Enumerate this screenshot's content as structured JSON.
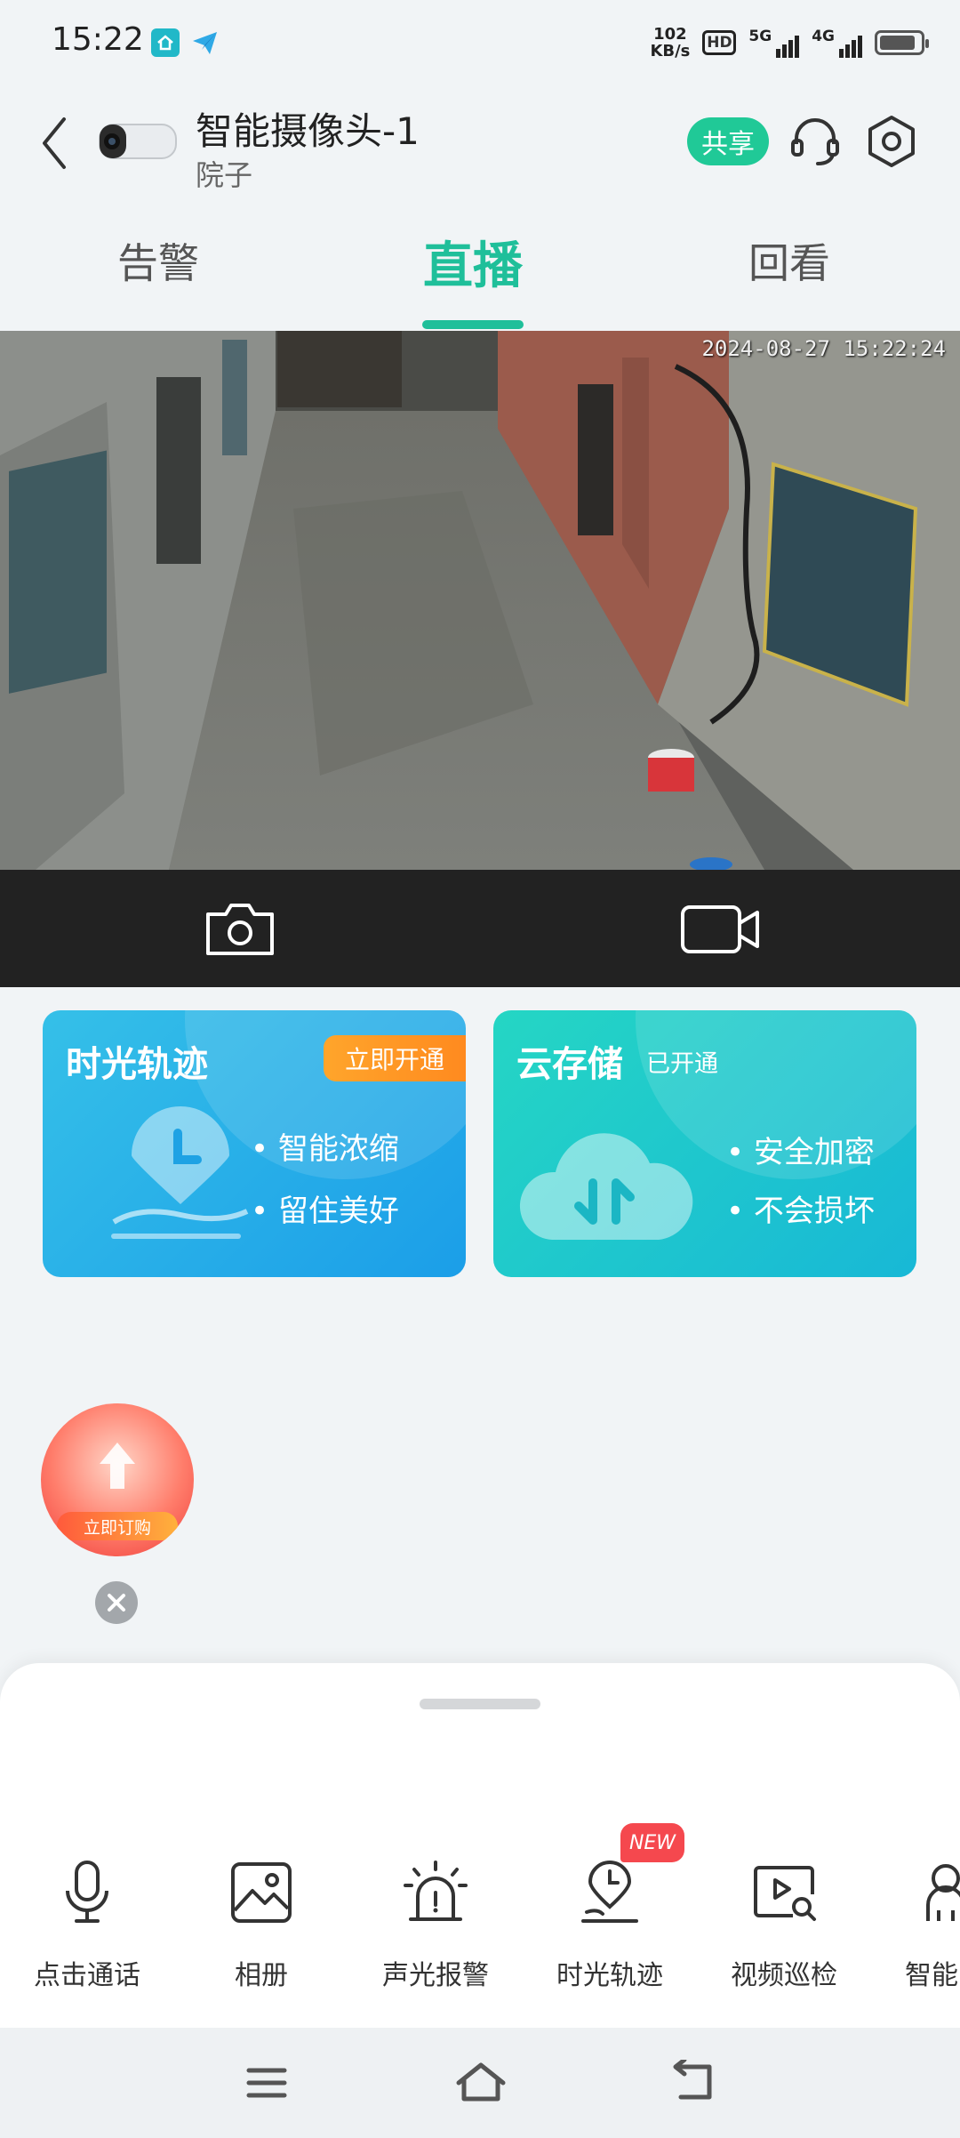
{
  "status_bar": {
    "time": "15:22",
    "net_speed_value": "102",
    "net_speed_unit": "KB/s",
    "hd_label": "HD",
    "signal1_label": "5G",
    "signal2_label": "4G"
  },
  "header": {
    "device_name": "智能摄像头-1",
    "device_location": "院子",
    "share_label": "共享"
  },
  "tabs": [
    {
      "label": "告警",
      "active": false
    },
    {
      "label": "直播",
      "active": true
    },
    {
      "label": "回看",
      "active": false
    }
  ],
  "video": {
    "timestamp": "2024-08-27 15:22:24"
  },
  "cards": {
    "timelapse": {
      "title": "时光轨迹",
      "cta": "立即开通",
      "features": [
        "• 智能浓缩",
        "• 留住美好"
      ]
    },
    "cloud": {
      "title": "云存储",
      "status": "已开通",
      "features": [
        "• 安全加密",
        "• 不会损坏"
      ]
    }
  },
  "float_ad": {
    "button_label": "立即订购"
  },
  "functions": [
    {
      "label": "点击通话",
      "icon": "microphone-icon"
    },
    {
      "label": "相册",
      "icon": "album-icon"
    },
    {
      "label": "声光报警",
      "icon": "alarm-light-icon"
    },
    {
      "label": "时光轨迹",
      "icon": "timelapse-icon",
      "badge": "NEW"
    },
    {
      "label": "视频巡检",
      "icon": "video-inspect-icon"
    },
    {
      "label": "智能",
      "icon": "smart-icon"
    }
  ],
  "colors": {
    "accent": "#1fbf9a",
    "share": "#20c997",
    "badge": "#f5484e",
    "cta": "#ff9a25"
  }
}
